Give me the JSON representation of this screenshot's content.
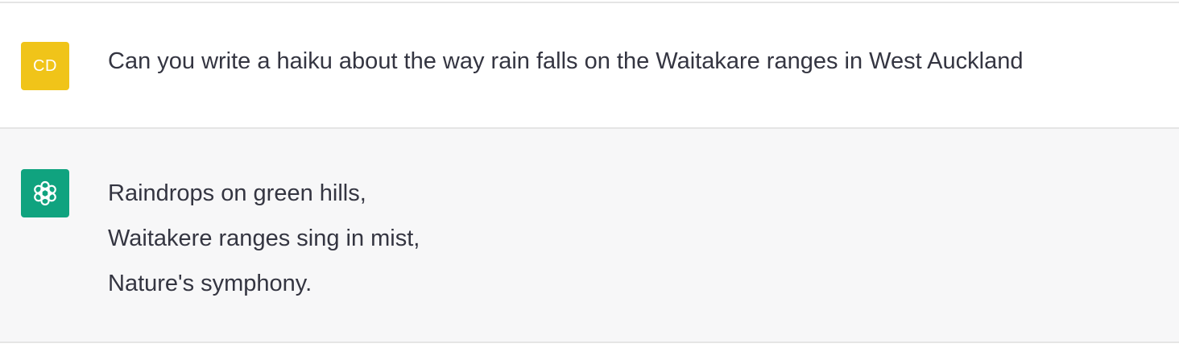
{
  "conversation": {
    "user_message": {
      "avatar_initials": "CD",
      "avatar_color": "#F0C419",
      "text": "Can you write a haiku about the way rain falls on the Waitakare ranges in West Auckland"
    },
    "assistant_message": {
      "avatar_icon": "openai-logo-icon",
      "avatar_color": "#10A37F",
      "lines": [
        "Raindrops on green hills,",
        "Waitakere ranges sing in mist,",
        "Nature's symphony."
      ]
    }
  }
}
